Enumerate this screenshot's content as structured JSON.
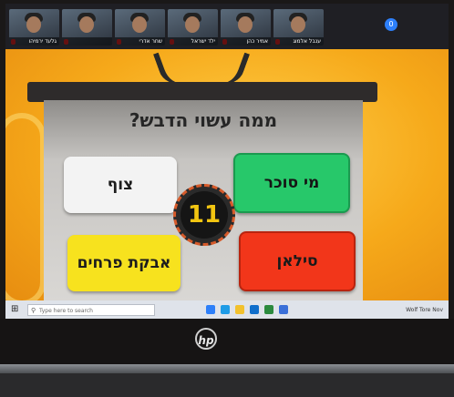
{
  "participants": [
    {
      "name": "גלעד ירמיהו"
    },
    {
      "name": ""
    },
    {
      "name": "שחר אדרי"
    },
    {
      "name": "ילד ישראל"
    },
    {
      "name": "אמיר כהן"
    },
    {
      "name": "ענבל אלמוג"
    }
  ],
  "more_participants": "0",
  "game": {
    "question": "ממה עשוי הדבש?",
    "timer": "11",
    "answers": {
      "top_left": "צוף",
      "top_right": "מי סוכר",
      "bottom_left": "אבקת פרחים",
      "bottom_right": "סילאן"
    }
  },
  "colors": {
    "background": "#f6a91a",
    "answer_white": "#f3f3f3",
    "answer_green": "#27c86a",
    "answer_yellow": "#f7e21e",
    "answer_red": "#f2361a",
    "timer": "#f2c511"
  },
  "taskbar": {
    "search_placeholder": "Type here to search",
    "tray_text": "Wolf Tore Nov"
  },
  "laptop": {
    "logo": "hp"
  }
}
